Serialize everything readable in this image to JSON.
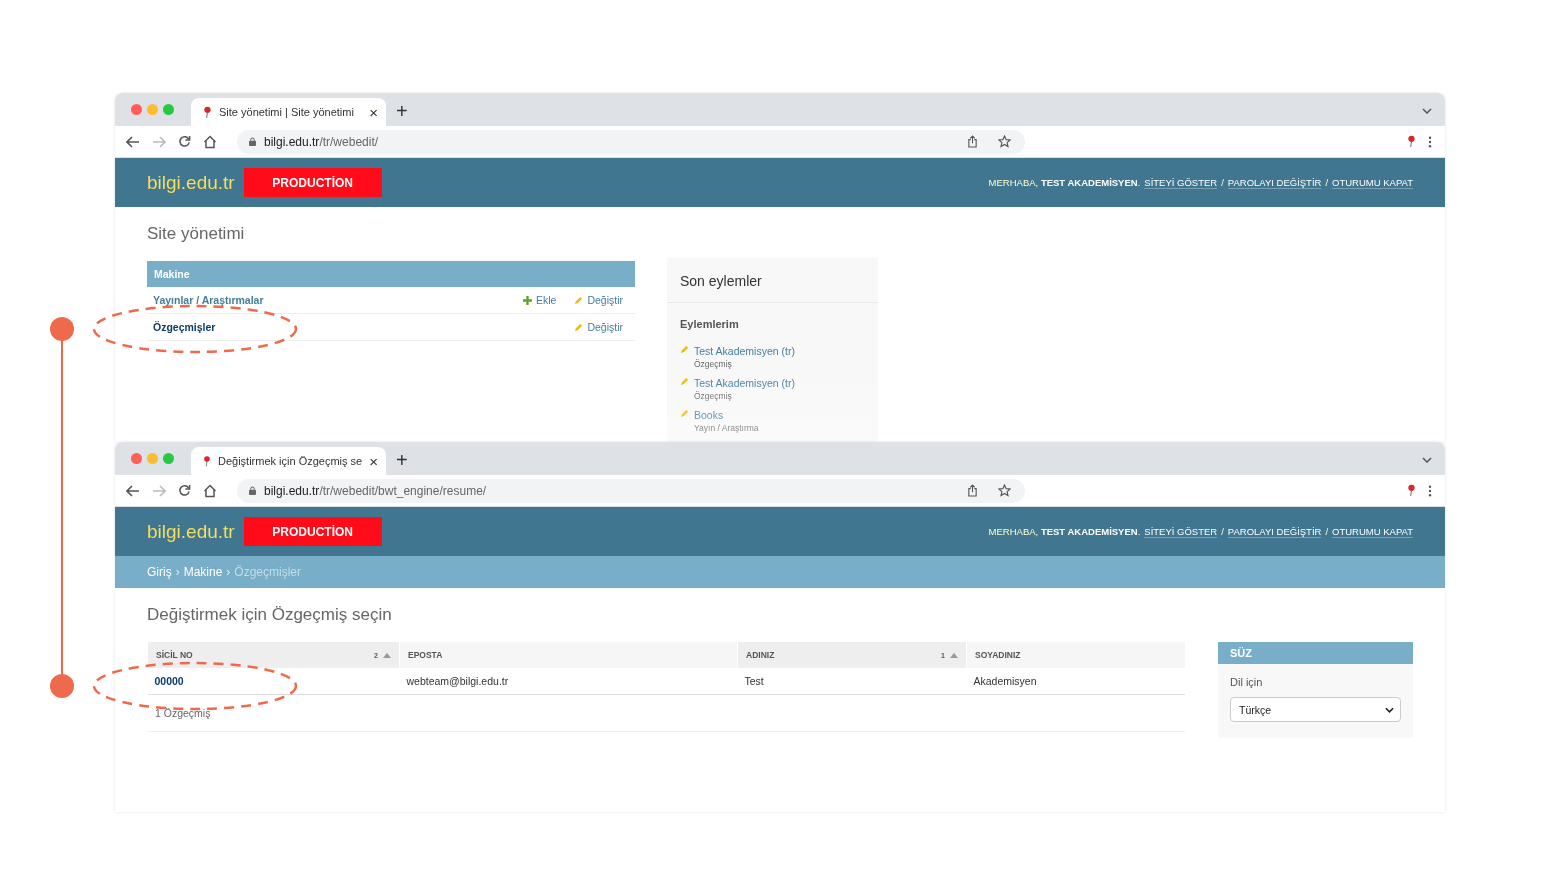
{
  "windows": [
    {
      "kind": "dashboard",
      "tab": {
        "title": "Site yönetimi | Site yönetimi",
        "close": "×"
      },
      "new_tab": "+",
      "forward_disabled": true,
      "url": {
        "domain": "bilgi.edu.tr",
        "path": "/tr/webedit/"
      },
      "header": {
        "site_name": "bilgi.edu.tr",
        "badge": "PRODUCTİON",
        "greeting": "MERHABA, **TEST AKADEMİSYEN**.",
        "links": [
          {
            "label": "SİTEYİ GÖSTER"
          },
          {
            "separator": "/",
            "label": "PAROLAYI DEĞİŞTİR"
          },
          {
            "separator": "/",
            "label": "OTURUMU KAPAT"
          }
        ]
      },
      "page": {
        "title": "Site yönetimi",
        "module": {
          "caption": "Makine",
          "rows": [
            {
              "name": "Yayınlar / Araştırmalar",
              "highlighted": false,
              "add": "Ekle",
              "change": "Değiştir"
            },
            {
              "name": "Özgeçmişler",
              "highlighted": true,
              "change": "Değiştir"
            }
          ]
        },
        "recent_actions": {
          "title": "Son eylemler",
          "subtitle": "Eylemlerim",
          "items": [
            {
              "label": "Test Akademisyen (tr)",
              "type": "Özgeçmiş"
            },
            {
              "label": "Test Akademisyen (tr)",
              "type": "Özgeçmiş"
            },
            {
              "label": "Books",
              "type": "Yayın / Araştırma"
            }
          ]
        }
      }
    },
    {
      "kind": "changelist",
      "tab": {
        "title": "Değiştirmek için Özgeçmiş se",
        "close": "×"
      },
      "new_tab": "+",
      "forward_disabled": true,
      "url": {
        "domain": "bilgi.edu.tr",
        "path": "/tr/webedit/bwt_engine/resume/"
      },
      "header": {
        "site_name": "bilgi.edu.tr",
        "badge": "PRODUCTİON",
        "greeting": "MERHABA, **TEST AKADEMİSYEN**.",
        "links": [
          {
            "label": "SİTEYİ GÖSTER"
          },
          {
            "separator": "/",
            "label": "PAROLAYI DEĞİŞTİR"
          },
          {
            "separator": "/",
            "label": "OTURUMU KAPAT"
          }
        ]
      },
      "breadcrumbs": [
        {
          "label": "Giriş",
          "current": false
        },
        {
          "separator": "›",
          "label": "Makine",
          "current": false
        },
        {
          "separator": "›",
          "label": "Özgeçmişler",
          "current": true
        }
      ],
      "page": {
        "title": "Değiştirmek için Özgeçmiş seçin",
        "columns": [
          {
            "label": "SİCİL NO",
            "sorted": true,
            "priority": "2"
          },
          {
            "label": "EPOSTA",
            "sorted": false
          },
          {
            "label": "ADINIZ",
            "sorted": true,
            "priority": "1"
          },
          {
            "label": "SOYADINIZ",
            "sorted": false
          }
        ],
        "rows": [
          {
            "cells": [
              "00000",
              "webteam@bilgi.edu.tr",
              "Test",
              "Akademisyen"
            ]
          }
        ],
        "count": "1 Özgeçmiş",
        "filter": {
          "title": "SÜZ",
          "label": "Dil için",
          "value": "Türkçe"
        }
      }
    }
  ]
}
